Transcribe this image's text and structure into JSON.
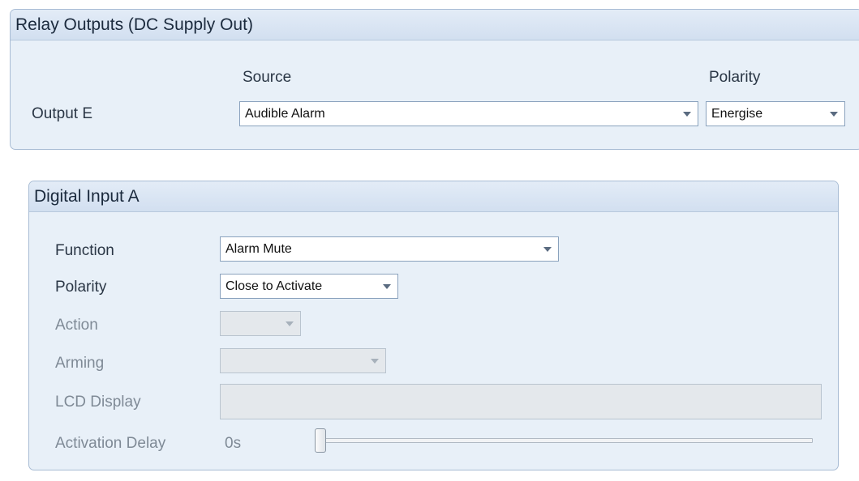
{
  "relay_panel": {
    "title": "Relay Outputs (DC Supply Out)",
    "source_header": "Source",
    "polarity_header": "Polarity",
    "output_label": "Output E",
    "source_value": "Audible Alarm",
    "polarity_value": "Energise"
  },
  "digital_input_panel": {
    "title": "Digital Input A",
    "function_label": "Function",
    "function_value": "Alarm Mute",
    "polarity_label": "Polarity",
    "polarity_value": "Close to Activate",
    "action_label": "Action",
    "action_value": "",
    "arming_label": "Arming",
    "arming_value": "",
    "lcd_display_label": "LCD Display",
    "lcd_display_value": "",
    "activation_delay_label": "Activation Delay",
    "activation_delay_value": "0s",
    "activation_delay_fraction": 0
  },
  "icons": {
    "dropdown": "chevron-down-icon"
  },
  "colors": {
    "panel_background": "#e8f0f8",
    "panel_border": "#a8bcd4",
    "disabled_text": "#7f8a96"
  }
}
